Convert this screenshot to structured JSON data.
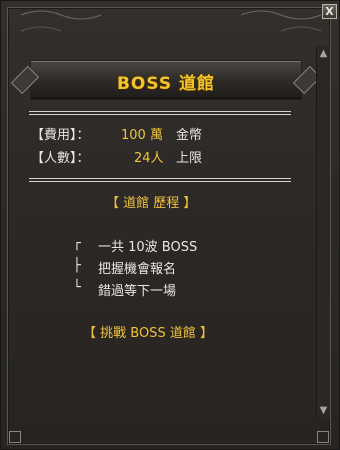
{
  "window": {
    "close_label": "X"
  },
  "header": {
    "title": "BOSS 道館"
  },
  "info": {
    "fee_label": "【費用】：",
    "fee_value": "100 萬",
    "fee_unit": "金幣",
    "people_label": "【人數】：",
    "people_value": "24人",
    "people_unit": "上限"
  },
  "history": {
    "title": "【 道館 歷程 】",
    "items": [
      {
        "bullet": "┌",
        "text": "一共 10波 BOSS"
      },
      {
        "bullet": "├",
        "text": "把握機會報名"
      },
      {
        "bullet": "└",
        "text": "錯過等下一場"
      }
    ]
  },
  "challenge": {
    "label": "【 挑戰 BOSS 道館 】"
  },
  "colors": {
    "accent": "#f1c23a",
    "text": "#e9e7e3",
    "bg": "#2b2825"
  }
}
